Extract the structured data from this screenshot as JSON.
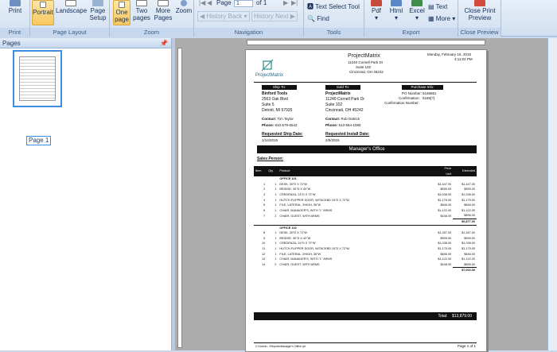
{
  "ribbon": {
    "print": "Print",
    "portrait": "Portrait",
    "landscape": "Landscape",
    "page_setup_l1": "Page",
    "page_setup_l2": "Setup",
    "one_page_l1": "One",
    "one_page_l2": "page",
    "two_pages_l1": "Two",
    "two_pages_l2": "pages",
    "more_pages_l1": "More",
    "more_pages_l2": "Pages",
    "zoom": "Zoom",
    "page_label": "Page",
    "page_value": "1",
    "of_label": "of 1",
    "history_back": "History Back",
    "history_next": "History Next",
    "text_select": "Text Select Tool",
    "find": "Find",
    "pdf": "Pdf",
    "html": "Html",
    "excel": "Excel",
    "text": "Text",
    "more": "More",
    "close_l1": "Close Print",
    "close_l2": "Preview",
    "groups": {
      "print": "Print",
      "page_layout": "Page Layout",
      "zoom": "Zoom",
      "navigation": "Navigation",
      "tools": "Tools",
      "export": "Export",
      "close": "Close Preview"
    }
  },
  "pages_panel": {
    "title": "Pages",
    "pin": "📌",
    "thumb_label": "Page 1"
  },
  "report": {
    "company": "ProjectMatrix",
    "address1": "11240 Cornell Park Dr",
    "address2": "Suite 102",
    "address3": "Cincinnati, OH 45242",
    "date": "Monday, February 16, 2015",
    "time": "4:11:02 PM",
    "logo_text": "ProjectMatrix",
    "ship_to": "Ship To:",
    "sold_to": "Sold To:",
    "po_info": "Purchase Info:",
    "ship_name": "Binford Tools",
    "ship_addr1": "2563 Oak Blvd",
    "ship_addr2": "Suite 5",
    "ship_addr3": "Detroit, MI 57935",
    "sold_name": "ProjectMatrix",
    "sold_addr1": "11240 Cornell Park Dr",
    "sold_addr2": "Suite 102",
    "sold_addr3": "Cincinnati, OH 45242",
    "po_l1": "PO Number:",
    "po_v1": "5165851",
    "po_l2": "Confirmation:",
    "po_v2": "5165[?]",
    "po_l3": "Confirmation Number:",
    "contact_l": "Contact:",
    "contact_v1": "Tim Taylor",
    "contact_v2": "Rob Datrick",
    "phone_l": "Phone:",
    "phone_v1": "810-579-6542",
    "phone_v2": "513-554-1065",
    "req_ship": "Requested Ship Date:",
    "req_ship_v": "1/14/2015",
    "req_install": "Requested Install Date:",
    "req_install_v": "2/5/2015",
    "section": "Manager's Office",
    "sales_person": "Sales Person:",
    "col_item": "Item",
    "col_qty": "Qty",
    "col_product": "Product",
    "col_price": "Price",
    "col_unit": "Unit",
    "col_ext": "Extended",
    "group1_title": "OFFICE 101",
    "group2_title": "OFFICE 102",
    "rows1": [
      {
        "item": "1",
        "qty": "1",
        "product": "DESK, 30\"D X 72\"W",
        "unit": "$1,447.00",
        "ext": "$1,447.00"
      },
      {
        "item": "2",
        "qty": "1",
        "product": "BRIDGE, 30\"D X 42\"W",
        "unit": "$599.00",
        "ext": "$599.00"
      },
      {
        "item": "3",
        "qty": "1",
        "product": "CREDENZA, 24\"D X 72\"W",
        "unit": "$1,038.00",
        "ext": "$1,038.00"
      },
      {
        "item": "4",
        "qty": "1",
        "product": "HUTCH FLIPPER DOOR, W/TACKBD 15\"D X 72\"W",
        "unit": "$1,175.00",
        "ext": "$1,175.00"
      },
      {
        "item": "5",
        "qty": "1",
        "product": "FILE, LATERAL, 2HIGH, 36\"W",
        "unit": "$846.00",
        "ext": "$846.00"
      },
      {
        "item": "6",
        "qty": "1",
        "product": "CHAIR, MANAGER'S, WITH \"L\" ARMS",
        "unit": "$1,122.00",
        "ext": "$1,122.00"
      },
      {
        "item": "7",
        "qty": "2",
        "product": "CHAIR, GUEST, WITH ARMS",
        "unit": "$448.00",
        "ext": "$896.00"
      }
    ],
    "subtotal1": "$6,877.00",
    "rows2": [
      {
        "item": "8",
        "qty": "1",
        "product": "DESK, 30\"D X 72\"W",
        "unit": "$1,267.00",
        "ext": "$1,267.00"
      },
      {
        "item": "9",
        "qty": "1",
        "product": "BRIDGE, 30\"D X 42\"W",
        "unit": "$599.00",
        "ext": "$599.00"
      },
      {
        "item": "10",
        "qty": "1",
        "product": "CREDENZA, 24\"D X 72\"W",
        "unit": "$1,038.00",
        "ext": "$1,038.00"
      },
      {
        "item": "11",
        "qty": "1",
        "product": "HUTCH FLIPPER DOOR, W/TACKBD 15\"D X 72\"W",
        "unit": "$1,175.00",
        "ext": "$1,175.00"
      },
      {
        "item": "12",
        "qty": "1",
        "product": "FILE, LATERAL, 2HIGH, 36\"W",
        "unit": "$846.00",
        "ext": "$846.00"
      },
      {
        "item": "13",
        "qty": "1",
        "product": "CHAIR, MANAGER'S, WITH \"L\" ARMS",
        "unit": "$1,122.00",
        "ext": "$1,122.00"
      },
      {
        "item": "14",
        "qty": "2",
        "product": "CHAIR, GUEST, WITH ARMS",
        "unit": "$448.00",
        "ext": "$896.00"
      }
    ],
    "subtotal2": "$7,002.00",
    "total_label": "Total:",
    "total_value": "$13,879.00",
    "footer_path": "C:\\Users\\...\\Reports\\Manager's Office.rpt",
    "footer_page": "Page 1 of 1"
  }
}
